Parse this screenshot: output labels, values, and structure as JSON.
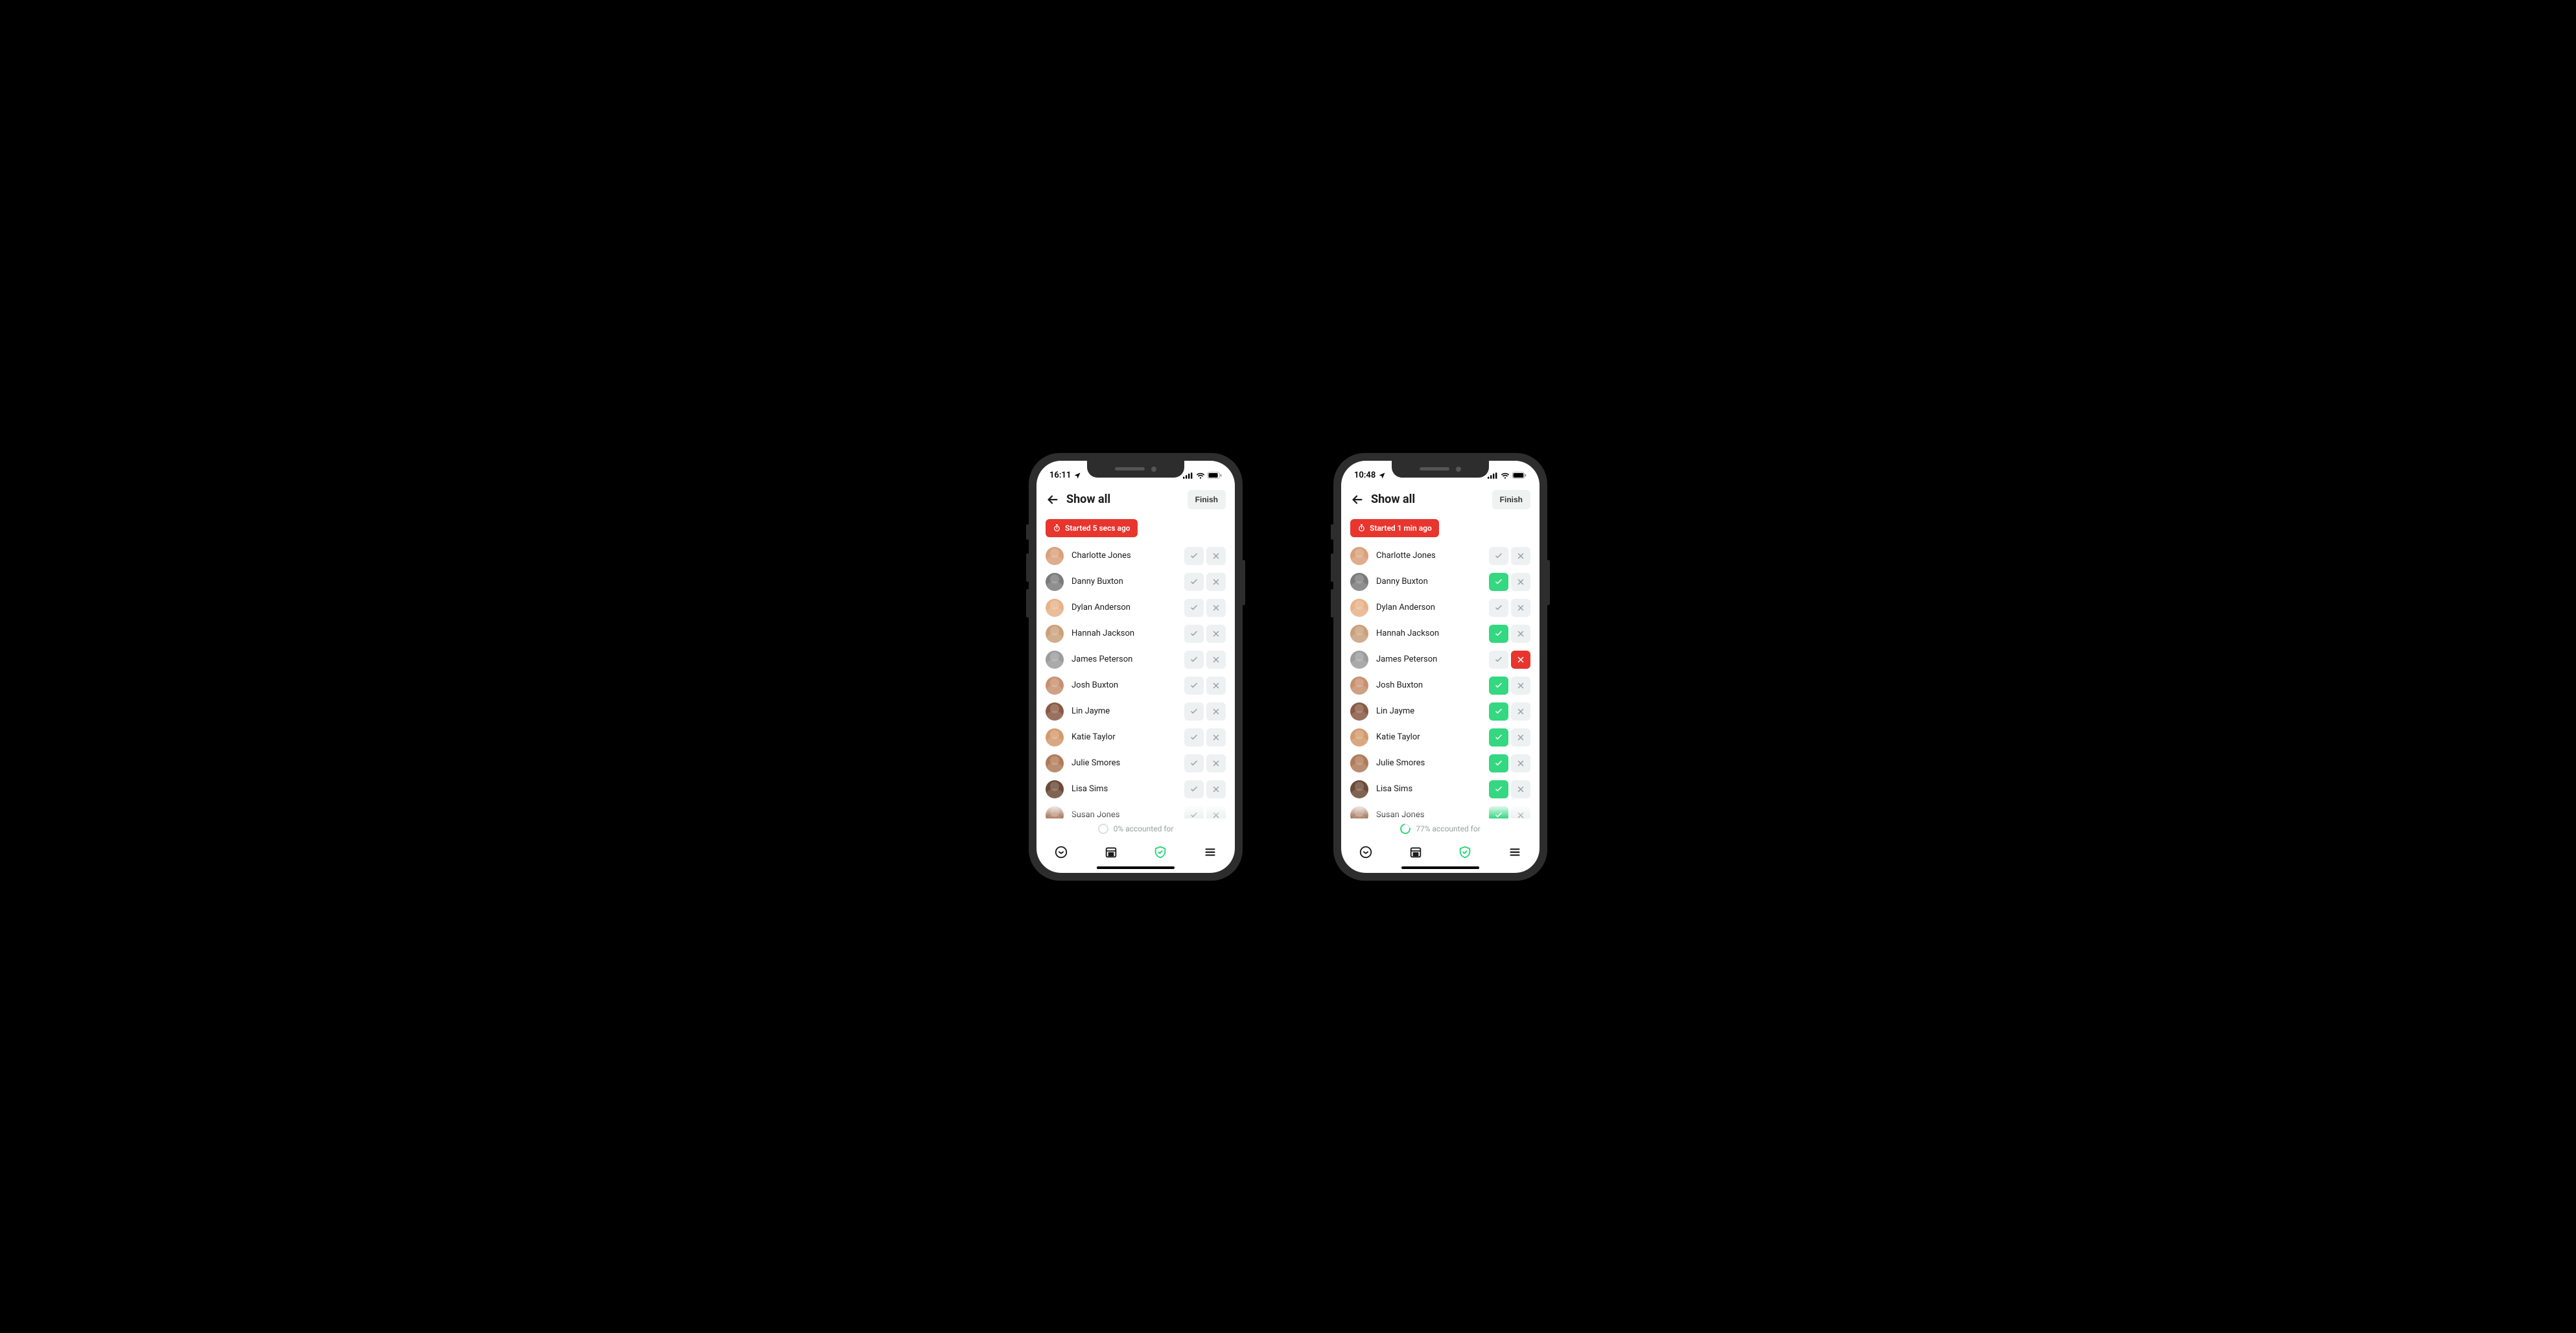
{
  "colors": {
    "accent_green": "#34d880",
    "accent_red": "#e8352d",
    "neutral_btn": "#eef1f1",
    "text_muted": "#9aa0a0"
  },
  "phones": [
    {
      "status": {
        "time": "16:11"
      },
      "header": {
        "title": "Show all",
        "finish_label": "Finish"
      },
      "started_label": "Started 5 secs ago",
      "progress": {
        "label": "0% accounted for",
        "state": "empty"
      },
      "people": [
        {
          "name": "Charlotte Jones",
          "check": "off",
          "cross": "off",
          "bg": "#d9a07a",
          "gray": false
        },
        {
          "name": "Danny Buxton",
          "check": "off",
          "cross": "off",
          "bg": "#7b7b7b",
          "gray": true
        },
        {
          "name": "Dylan Anderson",
          "check": "off",
          "cross": "off",
          "bg": "#e7b28a",
          "gray": false
        },
        {
          "name": "Hannah Jackson",
          "check": "off",
          "cross": "off",
          "bg": "#caa07a",
          "gray": false
        },
        {
          "name": "James Peterson",
          "check": "off",
          "cross": "off",
          "bg": "#9c9c9c",
          "gray": true
        },
        {
          "name": "Josh Buxton",
          "check": "off",
          "cross": "off",
          "bg": "#c89070",
          "gray": false
        },
        {
          "name": "Lin Jayme",
          "check": "off",
          "cross": "off",
          "bg": "#8a5a44",
          "gray": false
        },
        {
          "name": "Katie Taylor",
          "check": "off",
          "cross": "off",
          "bg": "#d39a6e",
          "gray": false
        },
        {
          "name": "Julie Smores",
          "check": "off",
          "cross": "off",
          "bg": "#b07a58",
          "gray": false
        },
        {
          "name": "Lisa Sims",
          "check": "off",
          "cross": "off",
          "bg": "#6b4a36",
          "gray": false
        },
        {
          "name": "Susan Jones",
          "check": "off",
          "cross": "off",
          "bg": "#a06a4e",
          "gray": false
        }
      ]
    },
    {
      "status": {
        "time": "10:48"
      },
      "header": {
        "title": "Show all",
        "finish_label": "Finish"
      },
      "started_label": "Started 1 min ago",
      "progress": {
        "label": "77% accounted for",
        "state": "partial"
      },
      "people": [
        {
          "name": "Charlotte Jones",
          "check": "off",
          "cross": "off",
          "bg": "#d9a07a",
          "gray": false
        },
        {
          "name": "Danny Buxton",
          "check": "on",
          "cross": "off",
          "bg": "#7b7b7b",
          "gray": true
        },
        {
          "name": "Dylan Anderson",
          "check": "off",
          "cross": "off",
          "bg": "#e7b28a",
          "gray": false
        },
        {
          "name": "Hannah Jackson",
          "check": "on",
          "cross": "off",
          "bg": "#caa07a",
          "gray": false
        },
        {
          "name": "James Peterson",
          "check": "off",
          "cross": "on",
          "bg": "#9c9c9c",
          "gray": true
        },
        {
          "name": "Josh Buxton",
          "check": "on",
          "cross": "off",
          "bg": "#c89070",
          "gray": false
        },
        {
          "name": "Lin Jayme",
          "check": "on",
          "cross": "off",
          "bg": "#8a5a44",
          "gray": false
        },
        {
          "name": "Katie Taylor",
          "check": "on",
          "cross": "off",
          "bg": "#d39a6e",
          "gray": false
        },
        {
          "name": "Julie Smores",
          "check": "on",
          "cross": "off",
          "bg": "#b07a58",
          "gray": false
        },
        {
          "name": "Lisa Sims",
          "check": "on",
          "cross": "off",
          "bg": "#6b4a36",
          "gray": false
        },
        {
          "name": "Susan Jones",
          "check": "on",
          "cross": "off",
          "bg": "#a06a4e",
          "gray": false
        }
      ]
    }
  ]
}
